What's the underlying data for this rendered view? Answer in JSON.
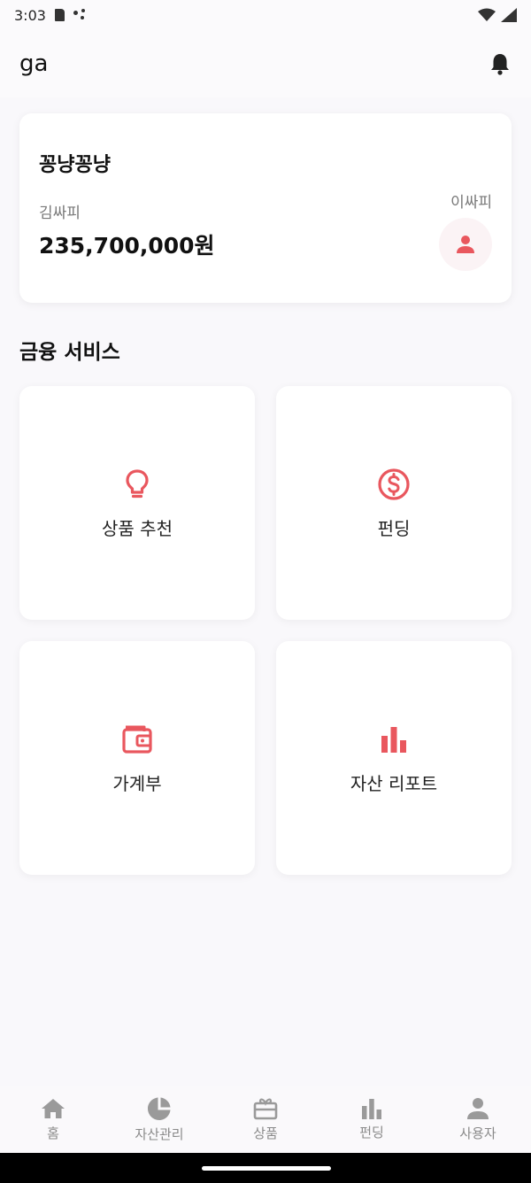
{
  "status_bar": {
    "time": "3:03"
  },
  "header": {
    "title": "ga"
  },
  "account_card": {
    "title": "꽁냥꽁냥",
    "owner_name": "김싸피",
    "amount": "235,700,000원",
    "partner_name": "이싸피"
  },
  "services": {
    "title": "금융 서비스",
    "items": [
      {
        "label": "상품 추천",
        "icon": "lightbulb-icon"
      },
      {
        "label": "펀딩",
        "icon": "dollar-circle-icon"
      },
      {
        "label": "가계부",
        "icon": "wallet-icon"
      },
      {
        "label": "자산 리포트",
        "icon": "bar-chart-icon"
      }
    ]
  },
  "bottom_nav": {
    "items": [
      {
        "label": "홈",
        "icon": "home-icon"
      },
      {
        "label": "자산관리",
        "icon": "pie-chart-icon"
      },
      {
        "label": "상품",
        "icon": "gift-icon"
      },
      {
        "label": "펀딩",
        "icon": "bar-chart-icon"
      },
      {
        "label": "사용자",
        "icon": "user-icon"
      }
    ]
  },
  "colors": {
    "accent": "#e9575e",
    "nav_icon": "#9a9a9a"
  }
}
